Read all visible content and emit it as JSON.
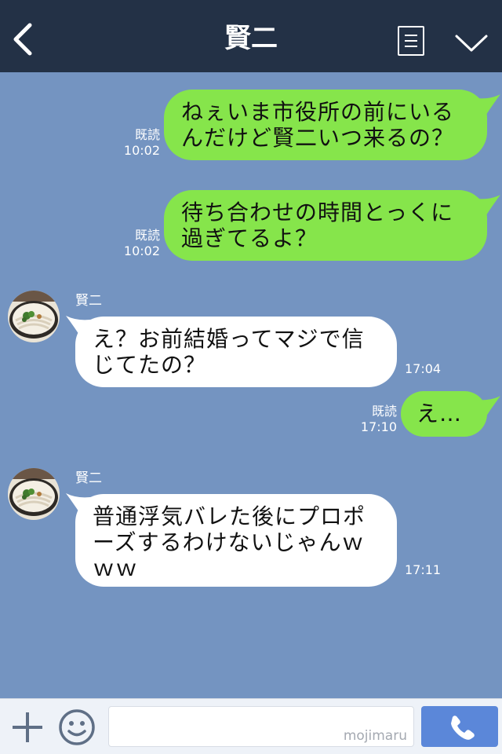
{
  "header": {
    "title": "賢二"
  },
  "messages": [
    {
      "direction": "out",
      "text_lines": [
        "ねぇいま市役所の前にいる",
        "んだけど賢二いつ来るの？"
      ],
      "read": "既読",
      "time": "10:02"
    },
    {
      "direction": "out",
      "text_lines": [
        "待ち合わせの時間とっくに",
        "過ぎてるよ？"
      ],
      "read": "既読",
      "time": "10:02"
    },
    {
      "direction": "in",
      "sender": "賢二",
      "text_lines": [
        "え？お前結婚ってマジで信",
        "じてたの？"
      ],
      "time": "17:04"
    },
    {
      "direction": "out",
      "text_lines": [
        "え…"
      ],
      "read": "既読",
      "time": "17:10"
    },
    {
      "direction": "in",
      "sender": "賢二",
      "text_lines": [
        "普通浮気バレた後にプロポ",
        "ーズするわけないじゃんｗ",
        "ｗｗ"
      ],
      "time": "17:11"
    }
  ],
  "input": {
    "watermark": "mojimaru"
  },
  "colors": {
    "header_bg": "#233146",
    "chat_bg": "#7494c1",
    "outgoing_bubble": "#86e54b",
    "incoming_bubble": "#ffffff",
    "call_button": "#5b87d9"
  },
  "icons": {
    "back": "chevron-left-icon",
    "menu": "list-menu-icon",
    "collapse": "chevron-down-icon",
    "attach": "plus-icon",
    "emoji": "smiley-icon",
    "call": "phone-icon"
  }
}
